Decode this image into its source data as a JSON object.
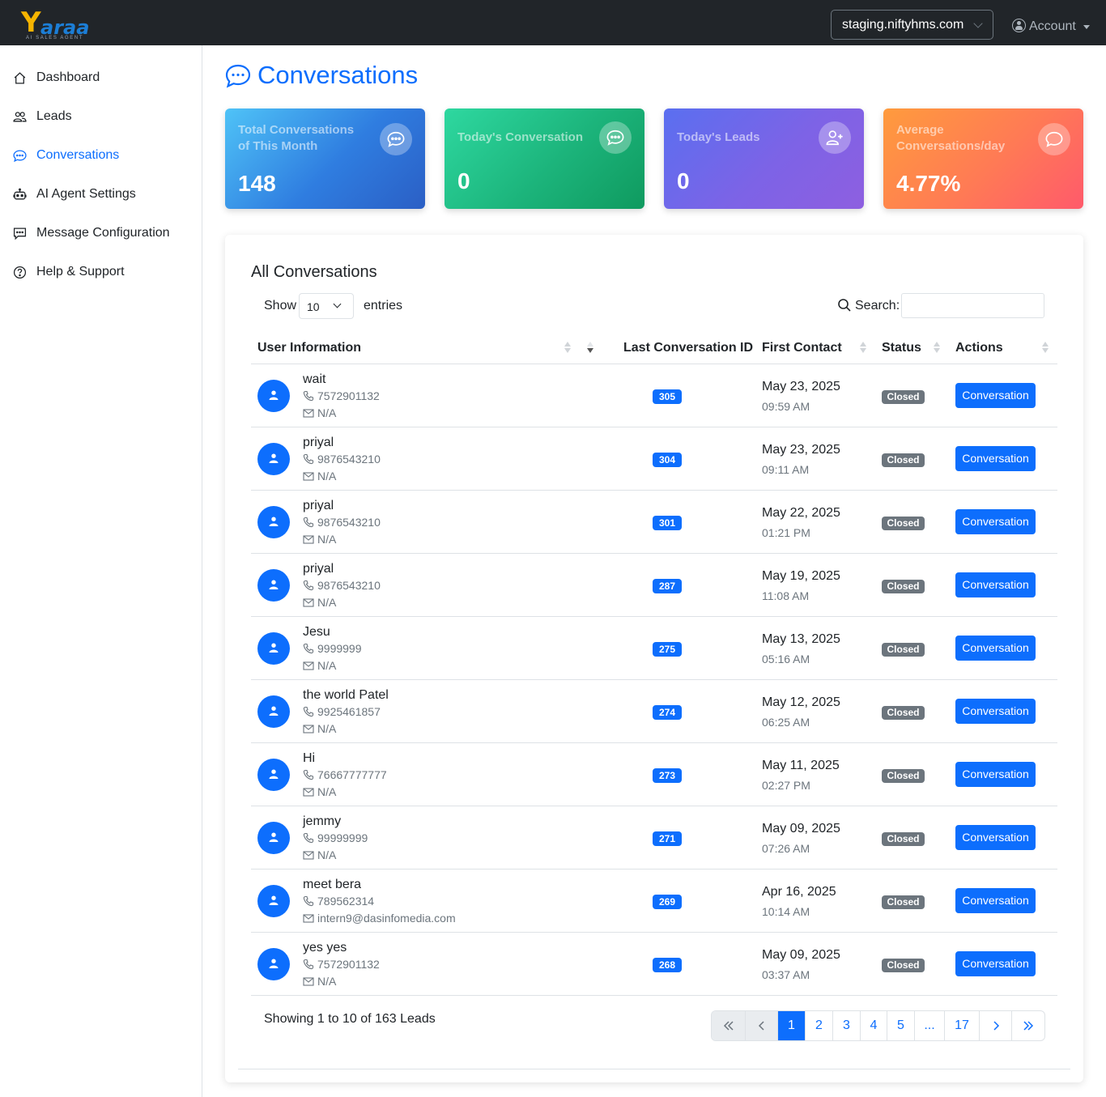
{
  "header": {
    "logo_text": "Yaraa",
    "logo_tagline": "AI SALES AGENT",
    "domain_select": "staging.niftyhms.com",
    "account_label": "Account"
  },
  "sidebar": {
    "items": [
      {
        "label": "Dashboard",
        "icon": "home-icon",
        "active": false
      },
      {
        "label": "Leads",
        "icon": "people-icon",
        "active": false
      },
      {
        "label": "Conversations",
        "icon": "chat-dots-icon",
        "active": true
      },
      {
        "label": "AI Agent Settings",
        "icon": "robot-icon",
        "active": false
      },
      {
        "label": "Message Configuration",
        "icon": "chat-square-icon",
        "active": false
      },
      {
        "label": "Help & Support",
        "icon": "question-circle-icon",
        "active": false
      }
    ]
  },
  "page": {
    "title": "Conversations"
  },
  "stats": [
    {
      "label": "Total Conversations of This Month",
      "value": "148",
      "icon": "chat-dots-icon"
    },
    {
      "label": "Today's Conversation",
      "value": "0",
      "icon": "chat-dots-icon"
    },
    {
      "label": "Today's Leads",
      "value": "0",
      "icon": "person-plus-icon"
    },
    {
      "label": "Average Conversations/day",
      "value": "4.77%",
      "icon": "chat-icon"
    }
  ],
  "table": {
    "title": "All Conversations",
    "show_label": "Show",
    "entries_value": "10",
    "entries_label": "entries",
    "search_label": "Search:",
    "search_value": "",
    "columns": [
      "User Information",
      "Last Conversation ID",
      "First Contact",
      "Status",
      "Actions"
    ],
    "rows": [
      {
        "name": "wait",
        "phone": "7572901132",
        "email": "N/A",
        "conv_id": "305",
        "date": "May 23, 2025",
        "time": "09:59 AM",
        "status": "Closed",
        "action": "Conversation"
      },
      {
        "name": "priyal",
        "phone": "9876543210",
        "email": "N/A",
        "conv_id": "304",
        "date": "May 23, 2025",
        "time": "09:11 AM",
        "status": "Closed",
        "action": "Conversation"
      },
      {
        "name": "priyal",
        "phone": "9876543210",
        "email": "N/A",
        "conv_id": "301",
        "date": "May 22, 2025",
        "time": "01:21 PM",
        "status": "Closed",
        "action": "Conversation"
      },
      {
        "name": "priyal",
        "phone": "9876543210",
        "email": "N/A",
        "conv_id": "287",
        "date": "May 19, 2025",
        "time": "11:08 AM",
        "status": "Closed",
        "action": "Conversation"
      },
      {
        "name": "Jesu",
        "phone": "9999999",
        "email": "N/A",
        "conv_id": "275",
        "date": "May 13, 2025",
        "time": "05:16 AM",
        "status": "Closed",
        "action": "Conversation"
      },
      {
        "name": "the world Patel",
        "phone": "9925461857",
        "email": "N/A",
        "conv_id": "274",
        "date": "May 12, 2025",
        "time": "06:25 AM",
        "status": "Closed",
        "action": "Conversation"
      },
      {
        "name": "Hi",
        "phone": "76667777777",
        "email": "N/A",
        "conv_id": "273",
        "date": "May 11, 2025",
        "time": "02:27 PM",
        "status": "Closed",
        "action": "Conversation"
      },
      {
        "name": "jemmy",
        "phone": "99999999",
        "email": "N/A",
        "conv_id": "271",
        "date": "May 09, 2025",
        "time": "07:26 AM",
        "status": "Closed",
        "action": "Conversation"
      },
      {
        "name": "meet bera",
        "phone": "789562314",
        "email": "intern9@dasinfomedia.com",
        "conv_id": "269",
        "date": "Apr 16, 2025",
        "time": "10:14 AM",
        "status": "Closed",
        "action": "Conversation"
      },
      {
        "name": "yes yes",
        "phone": "7572901132",
        "email": "N/A",
        "conv_id": "268",
        "date": "May 09, 2025",
        "time": "03:37 AM",
        "status": "Closed",
        "action": "Conversation"
      }
    ],
    "footer_text": "Showing 1 to 10 of 163 Leads",
    "pagination": [
      "1",
      "2",
      "3",
      "4",
      "5",
      "...",
      "17"
    ],
    "current_page": "1"
  },
  "colors": {
    "primary": "#0d6efd",
    "topbar": "#212529",
    "status_closed": "#6c757d"
  }
}
